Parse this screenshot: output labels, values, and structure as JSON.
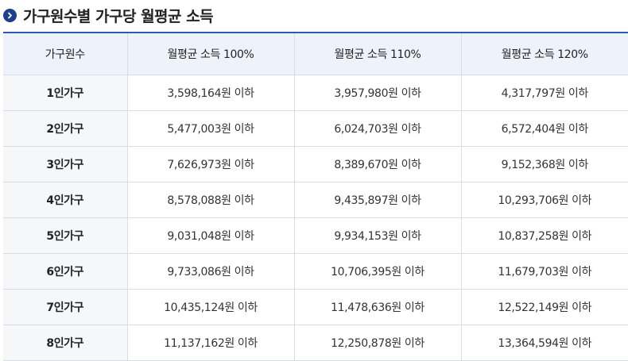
{
  "heading": {
    "icon": "chevron-right-icon",
    "title": "가구원수별 가구당 월평균 소득"
  },
  "colors": {
    "icon_bg": "#1e3f8a",
    "table_top_border": "#2b5bb6",
    "header_bg": "#eef3fb",
    "row_header_bg": "#f6f7f9",
    "grid_line": "#d9dde3"
  },
  "table": {
    "columns": [
      "가구원수",
      "월평균 소득 100%",
      "월평균 소득 110%",
      "월평균 소득 120%"
    ],
    "rows": [
      [
        "1인가구",
        "3,598,164원 이하",
        "3,957,980원 이하",
        "4,317,797원 이하"
      ],
      [
        "2인가구",
        "5,477,003원 이하",
        "6,024,703원 이하",
        "6,572,404원 이하"
      ],
      [
        "3인가구",
        "7,626,973원 이하",
        "8,389,670원 이하",
        "9,152,368원 이하"
      ],
      [
        "4인가구",
        "8,578,088원 이하",
        "9,435,897원 이하",
        "10,293,706원 이하"
      ],
      [
        "5인가구",
        "9,031,048원 이하",
        "9,934,153원 이하",
        "10,837,258원 이하"
      ],
      [
        "6인가구",
        "9,733,086원 이하",
        "10,706,395원 이하",
        "11,679,703원 이하"
      ],
      [
        "7인가구",
        "10,435,124원 이하",
        "11,478,636원 이하",
        "12,522,149원 이하"
      ],
      [
        "8인가구",
        "11,137,162원 이하",
        "12,250,878원 이하",
        "13,364,594원 이하"
      ]
    ]
  }
}
